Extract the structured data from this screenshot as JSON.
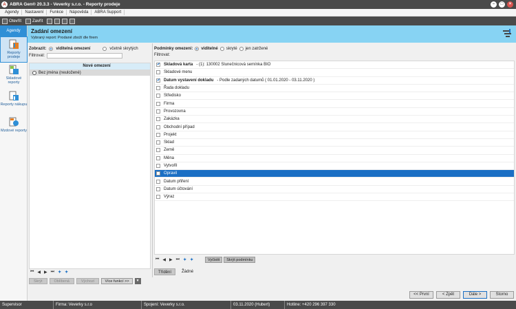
{
  "window": {
    "title": "ABRA Gen® 20.3.3 - Veverky s.r.o. - Reporty prodeje"
  },
  "menu": [
    "Agendy",
    "Nastavení",
    "Funkce",
    "Nápověda",
    "ABRA Support"
  ],
  "toolbar": {
    "open_label": "Otevřít",
    "close_label": "Zavřít"
  },
  "nav": {
    "agendy": "Agendy",
    "items": [
      {
        "label": "Reporty prodeje"
      },
      {
        "label": "Skladové reporty"
      },
      {
        "label": "Reporty nákupu"
      },
      {
        "label": "Mzdové reporty"
      }
    ]
  },
  "header": {
    "title": "Zadání omezení",
    "subtitle": "Vybraný report: Prodané zboží dle firem"
  },
  "left": {
    "show_label": "Zobrazit:",
    "opt_visible": "viditelná omezení",
    "opt_hidden": "včetně skrytých",
    "filter_label": "Filtrovat:",
    "filter_value": "",
    "grid_header": "Nové omezení",
    "rows": [
      "Bez jména (neuložené)"
    ],
    "buttons": {
      "hide": "Skrýt",
      "favorite": "Oblíbená",
      "default": "Výchozí",
      "more": "Více funkcí >>"
    }
  },
  "right": {
    "conditions_label": "Podmínky omezení:",
    "opt_visible": "viditelné",
    "opt_hidden": "skryté",
    "opt_filled": "jen zatržené",
    "filter_label": "Filtrovat:",
    "rows": [
      {
        "label": "Skladová karta",
        "detail": "- (1): 130002 Slunečnicová semínka BIO",
        "checked": true,
        "bold": true,
        "selected": false
      },
      {
        "label": "Skladové menu",
        "detail": "",
        "checked": false,
        "bold": false,
        "selected": false
      },
      {
        "label": "Datum vystavení dokladu",
        "detail": "- Podle zadaných datumů ( 01.01.2020 - 03.11.2020 )",
        "checked": true,
        "bold": true,
        "selected": false
      },
      {
        "label": "Řada dokladu",
        "detail": "",
        "checked": false,
        "bold": false,
        "selected": false
      },
      {
        "label": "Středisko",
        "detail": "",
        "checked": false,
        "bold": false,
        "selected": false
      },
      {
        "label": "Firma",
        "detail": "",
        "checked": false,
        "bold": false,
        "selected": false
      },
      {
        "label": "Provozovna",
        "detail": "",
        "checked": false,
        "bold": false,
        "selected": false
      },
      {
        "label": "Zakázka",
        "detail": "",
        "checked": false,
        "bold": false,
        "selected": false
      },
      {
        "label": "Obchodní případ",
        "detail": "",
        "checked": false,
        "bold": false,
        "selected": false
      },
      {
        "label": "Projekt",
        "detail": "",
        "checked": false,
        "bold": false,
        "selected": false
      },
      {
        "label": "Sklad",
        "detail": "",
        "checked": false,
        "bold": false,
        "selected": false
      },
      {
        "label": "Země",
        "detail": "",
        "checked": false,
        "bold": false,
        "selected": false
      },
      {
        "label": "Měna",
        "detail": "",
        "checked": false,
        "bold": false,
        "selected": false
      },
      {
        "label": "Vytvořil",
        "detail": "",
        "checked": false,
        "bold": false,
        "selected": false
      },
      {
        "label": "Opravil",
        "detail": "",
        "checked": false,
        "bold": false,
        "selected": true
      },
      {
        "label": "Datum přiření",
        "detail": "",
        "checked": false,
        "bold": false,
        "selected": false
      },
      {
        "label": "Datum účtování",
        "detail": "",
        "checked": false,
        "bold": false,
        "selected": false
      },
      {
        "label": "Výraz",
        "detail": "",
        "checked": false,
        "bold": false,
        "selected": false
      }
    ],
    "buttons": {
      "clear": "Vyčistit",
      "hide_cond": "Skrýt podmínku"
    }
  },
  "tabs": {
    "sort": "Třídění",
    "none": "Žádné"
  },
  "nav_buttons": {
    "first": "<< První",
    "back": "< Zpět",
    "next": "Dále >",
    "cancel": "Storno"
  },
  "status": {
    "user": "Supervisor",
    "firm": "Firma: Veverky s.r.o",
    "conn": "Spojení: Veverky s.r.o.",
    "date": "03.11.2020 (Hubert)",
    "hotline": "Hotline: +420 296 397 330"
  }
}
